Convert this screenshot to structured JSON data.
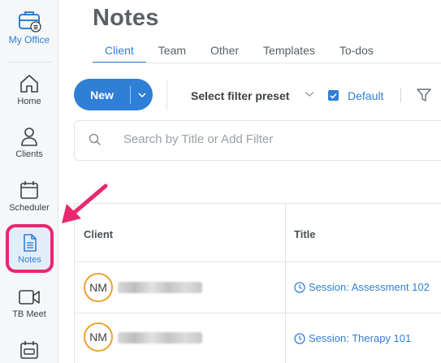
{
  "sidebar": {
    "my_office": "My Office",
    "items": [
      {
        "label": "Home",
        "icon": "home-icon"
      },
      {
        "label": "Clients",
        "icon": "person-icon"
      },
      {
        "label": "Scheduler",
        "icon": "calendar-icon"
      },
      {
        "label": "Notes",
        "icon": "document-icon"
      },
      {
        "label": "TB Meet",
        "icon": "video-icon"
      }
    ]
  },
  "header": {
    "title": "Notes",
    "tabs": [
      "Client",
      "Team",
      "Other",
      "Templates",
      "To-dos"
    ],
    "active_tab": "Client"
  },
  "toolbar": {
    "new_label": "New",
    "preset_label": "Select filter preset",
    "default_label": "Default",
    "default_checked": true
  },
  "search": {
    "placeholder": "Search by Title or Add Filter"
  },
  "table": {
    "columns": [
      "Client",
      "Title"
    ],
    "rows": [
      {
        "initials": "NM",
        "title": "Session: Assessment 102"
      },
      {
        "initials": "NM",
        "title": "Session: Therapy 101"
      }
    ]
  },
  "colors": {
    "accent": "#2f7fd6",
    "highlight": "#e8286e",
    "avatar_ring": "#f0a030"
  }
}
